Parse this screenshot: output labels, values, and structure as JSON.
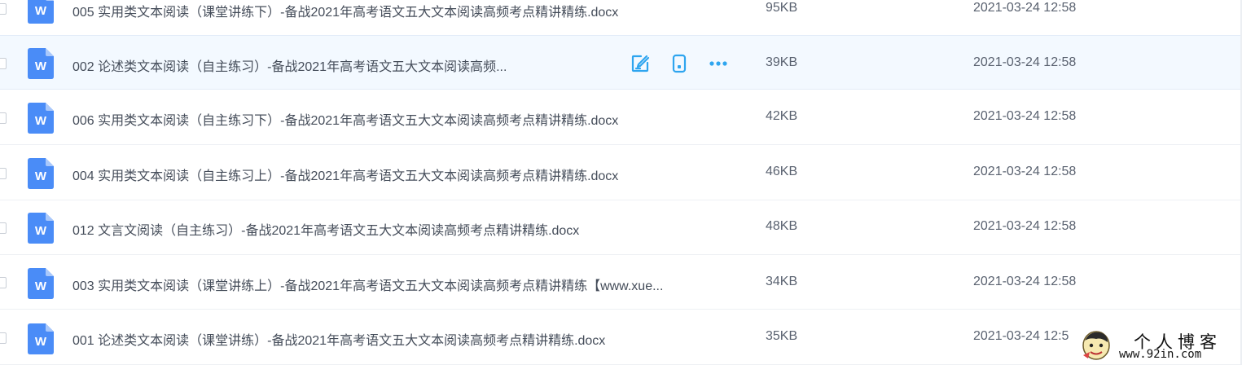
{
  "colors": {
    "accent": "#2ea5ef",
    "word_icon": "#4a8cf7",
    "hover_row": "#f3f9ff"
  },
  "actions": {
    "edit_icon": "edit-icon",
    "mobile_icon": "mobile-icon",
    "more_icon": "more-dots-icon"
  },
  "files": [
    {
      "name": "005 实用类文本阅读（课堂讲练下）-备战2021年高考语文五大文本阅读高频考点精讲精练.docx",
      "size": "95KB",
      "date": "2021-03-24 12:58",
      "type": "word-doc-icon"
    },
    {
      "name": "002 论述类文本阅读（自主练习）-备战2021年高考语文五大文本阅读高频...",
      "size": "39KB",
      "date": "2021-03-24 12:58",
      "type": "word-doc-icon",
      "hovered": true
    },
    {
      "name": "006 实用类文本阅读（自主练习下）-备战2021年高考语文五大文本阅读高频考点精讲精练.docx",
      "size": "42KB",
      "date": "2021-03-24 12:58",
      "type": "word-doc-icon"
    },
    {
      "name": "004 实用类文本阅读（自主练习上）-备战2021年高考语文五大文本阅读高频考点精讲精练.docx",
      "size": "46KB",
      "date": "2021-03-24 12:58",
      "type": "word-doc-icon"
    },
    {
      "name": "012 文言文阅读（自主练习）-备战2021年高考语文五大文本阅读高频考点精讲精练.docx",
      "size": "48KB",
      "date": "2021-03-24 12:58",
      "type": "word-doc-icon"
    },
    {
      "name": "003 实用类文本阅读（课堂讲练上）-备战2021年高考语文五大文本阅读高频考点精讲精练【www.xue...",
      "size": "34KB",
      "date": "2021-03-24 12:58",
      "type": "word-doc-icon"
    },
    {
      "name": "001 论述类文本阅读（课堂讲练）-备战2021年高考语文五大文本阅读高频考点精讲精练.docx",
      "size": "35KB",
      "date": "2021-03-24 12:5",
      "type": "word-doc-icon"
    }
  ],
  "watermark": {
    "title": "个人博客",
    "url": "www.92in.com"
  }
}
